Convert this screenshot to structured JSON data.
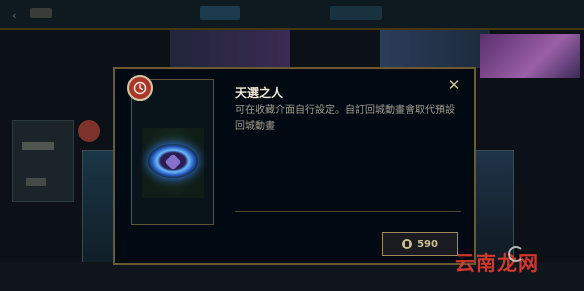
{
  "modal": {
    "title": "天選之人",
    "description": "可在收藏介面自行設定。自訂回城動畫會取代預設回城動畫",
    "close_glyph": "✕",
    "price": "590",
    "badge_icon": "clock-icon",
    "currency_icon": "rp-icon"
  },
  "watermark": {
    "text": "云南龙网"
  },
  "colors": {
    "gold_border": "#6a5a32",
    "gold_text": "#cdbe91",
    "title_text": "#f0e6d2",
    "body_text": "#a09b8c",
    "badge_red": "#a8372c",
    "watermark_red": "#e23a2e"
  }
}
